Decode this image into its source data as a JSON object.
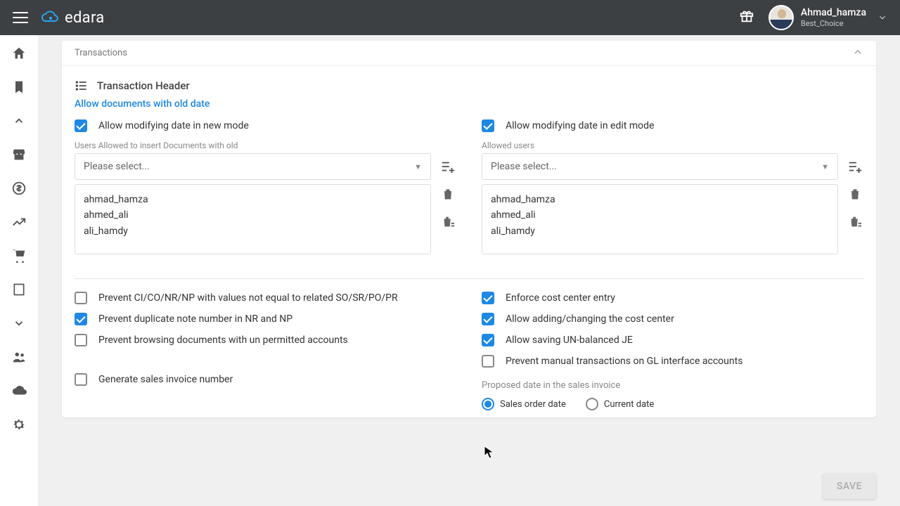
{
  "header": {
    "logo_text": "edara",
    "user_name": "Ahmad_hamza",
    "org": "Best_Choice"
  },
  "panel": {
    "title": "Transactions"
  },
  "section": {
    "title": "Transaction Header",
    "link": "Allow documents with old date"
  },
  "left": {
    "ck_modify_new": "Allow modifying date in new mode",
    "users_label": "Users Allowed to insert Documents with old",
    "select_placeholder": "Please select...",
    "users": [
      "ahmad_hamza",
      "ahmed_ali",
      "ali_hamdy"
    ],
    "ck_prevent_ci": "Prevent CI/CO/NR/NP with values not equal to related SO/SR/PO/PR",
    "ck_prevent_dup": "Prevent duplicate note number in NR and NP",
    "ck_prevent_browse": "Prevent browsing documents with un permitted accounts",
    "ck_gen_invoice": "Generate sales invoice number"
  },
  "right": {
    "ck_modify_edit": "Allow modifying date in edit mode",
    "users_label": "Allowed users",
    "select_placeholder": "Please select...",
    "users": [
      "ahmad_hamza",
      "ahmed_ali",
      "ali_hamdy"
    ],
    "ck_enforce_cc": "Enforce cost center entry",
    "ck_allow_cc": "Allow adding/changing the cost center",
    "ck_unbalanced": "Allow saving UN-balanced JE",
    "ck_prevent_manual": "Prevent manual transactions on GL interface accounts",
    "proposed_label": "Proposed date in the sales invoice",
    "radio1": "Sales order date",
    "radio2": "Current date"
  },
  "save": "SAVE"
}
